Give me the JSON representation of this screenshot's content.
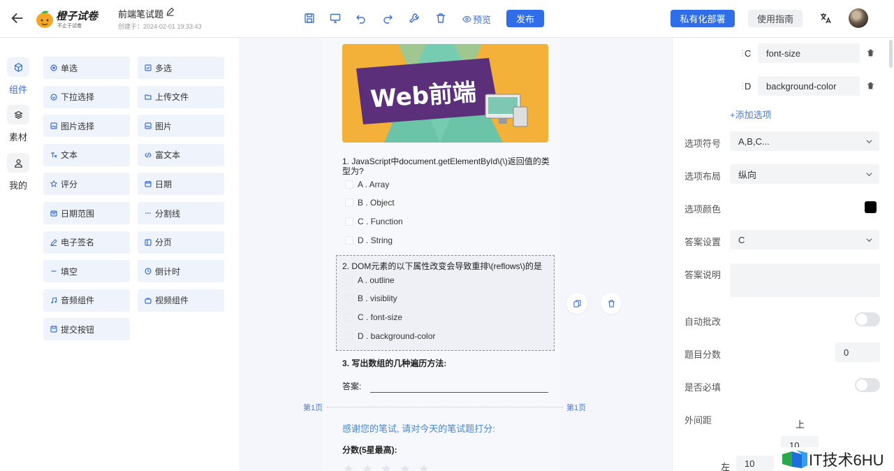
{
  "header": {
    "brand": "橙子试卷",
    "brand_sub": "不止于试卷",
    "doc_title": "前端笔试题",
    "created": "创建于：2024-02-01 19:33:43",
    "preview": "预览",
    "publish": "发布",
    "private_deploy": "私有化部署",
    "guide": "使用指南"
  },
  "rail": {
    "items": [
      {
        "label": "组件",
        "icon": "cube-icon",
        "active": true
      },
      {
        "label": "素材",
        "icon": "layers-icon",
        "active": false
      },
      {
        "label": "我的",
        "icon": "user-icon",
        "active": false
      }
    ]
  },
  "palette": {
    "items": [
      {
        "label": "单选",
        "icon": "radio-icon"
      },
      {
        "label": "多选",
        "icon": "checkbox-icon"
      },
      {
        "label": "下拉选择",
        "icon": "dropdown-icon"
      },
      {
        "label": "上传文件",
        "icon": "folder-icon"
      },
      {
        "label": "图片选择",
        "icon": "image-select-icon"
      },
      {
        "label": "图片",
        "icon": "image-icon"
      },
      {
        "label": "文本",
        "icon": "text-icon"
      },
      {
        "label": "富文本",
        "icon": "code-icon"
      },
      {
        "label": "评分",
        "icon": "star-icon"
      },
      {
        "label": "日期",
        "icon": "calendar-icon"
      },
      {
        "label": "日期范围",
        "icon": "date-range-icon"
      },
      {
        "label": "分割线",
        "icon": "divider-icon"
      },
      {
        "label": "电子签名",
        "icon": "pen-icon"
      },
      {
        "label": "分页",
        "icon": "page-icon"
      },
      {
        "label": "填空",
        "icon": "dash-icon"
      },
      {
        "label": "倒计时",
        "icon": "clock-icon"
      },
      {
        "label": "音频组件",
        "icon": "music-icon"
      },
      {
        "label": "视频组件",
        "icon": "video-icon"
      },
      {
        "label": "提交按钮",
        "icon": "save-icon"
      }
    ]
  },
  "canvas": {
    "banner_text": "Web前端",
    "q1": {
      "title": "1. JavaScript中document.getElementById\\(\\)返回值的类型为?",
      "options": [
        "A . Array",
        "B . Object",
        "C . Function",
        "D . String"
      ]
    },
    "q2": {
      "title": "2. DOM元素的以下属性改变会导致重排\\(reflows\\)的是",
      "options": [
        "A . outline",
        "B . visiblity",
        "C . font-size",
        "D . background-color"
      ]
    },
    "q3": {
      "title": "3. 写出数组的几种遍历方法:",
      "answer_label": "答案:"
    },
    "page_left": "第1页",
    "page_right": "第1页",
    "thanks": "感谢您的笔试, 请对今天的笔试题打分:",
    "score_label": "分数(5星最高):"
  },
  "panel": {
    "options": [
      {
        "letter": "C",
        "value": "font-size"
      },
      {
        "letter": "D",
        "value": "background-color"
      }
    ],
    "add_option": "+添加选项",
    "option_symbol_label": "选项符号",
    "option_symbol_value": "A,B,C...",
    "layout_label": "选项布局",
    "layout_value": "纵向",
    "color_label": "选项颜色",
    "option_color": "#000000",
    "answer_label": "答案设置",
    "answer_value": "C",
    "explain_label": "答案说明",
    "auto_grade_label": "自动批改",
    "score_label": "题目分数",
    "score_value": "0",
    "required_label": "是否必填",
    "margin_label": "外间距",
    "margin_top_label": "上",
    "margin_top_value": "10",
    "margin_left_label": "左",
    "margin_left_value": "10"
  },
  "watermark": "IT技术6HU",
  "colors": {
    "primary": "#2f6ee8",
    "link": "#4a78d6",
    "palette_bg": "#eef3fc",
    "canvas_bg": "#f4f6fb"
  }
}
